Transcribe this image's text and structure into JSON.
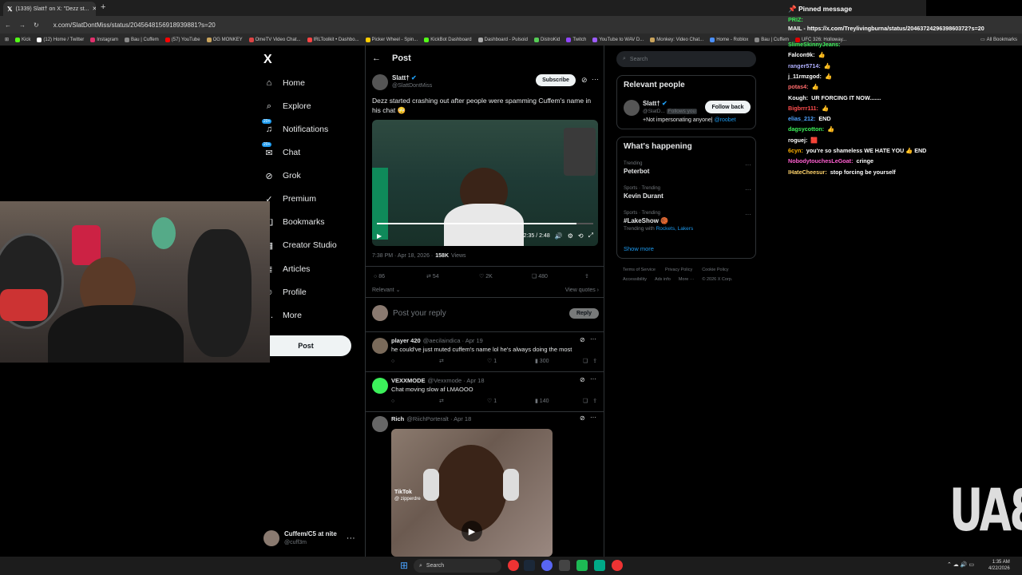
{
  "browser": {
    "tab_title": "(1339) Slatt† on X: \"Dezz st...",
    "url": "x.com/SlatDontMiss/status/2045648156918939881?s=20",
    "new_tab": "+",
    "bookmarks": [
      "Kick",
      "(12) Home / Twitter",
      "Instagram",
      "Bau | Cuffem",
      "(57) YouTube",
      "OG MONKEY",
      "OmeTV Video Chat...",
      "IRLToolkit • Dashbo...",
      "Picker Wheel - Spin...",
      "KickBot Dashboard",
      "Dashboard - Pulsoid",
      "DistroKid",
      "Twitch",
      "YouTube to WAV D...",
      "Monkey: Video Chat...",
      "Home - Roblox",
      "Bau | Cuffem",
      "UFC 326: Holloway..."
    ],
    "all_bookmarks": "All Bookmarks"
  },
  "nav": {
    "logo": "X",
    "items": [
      {
        "label": "Home",
        "icon": "home-icon",
        "glyph": "⌂"
      },
      {
        "label": "Explore",
        "icon": "search-icon",
        "glyph": "⌕"
      },
      {
        "label": "Notifications",
        "icon": "bell-icon",
        "glyph": "♫",
        "badge": "20+"
      },
      {
        "label": "Chat",
        "icon": "chat-icon",
        "glyph": "✉",
        "badge": "20+"
      },
      {
        "label": "Grok",
        "icon": "grok-icon",
        "glyph": "⊘"
      },
      {
        "label": "Premium",
        "icon": "premium-icon",
        "glyph": "✓"
      },
      {
        "label": "Bookmarks",
        "icon": "bookmark-icon",
        "glyph": "❏"
      },
      {
        "label": "Creator Studio",
        "icon": "studio-icon",
        "glyph": "▦"
      },
      {
        "label": "Articles",
        "icon": "articles-icon",
        "glyph": "≣"
      },
      {
        "label": "Profile",
        "icon": "profile-icon",
        "glyph": "☺"
      },
      {
        "label": "More",
        "icon": "more-icon",
        "glyph": "…"
      }
    ],
    "post_button": "Post",
    "account_name": "Cuffem/C5 at nite",
    "account_handle": "@cuff3m"
  },
  "post": {
    "header": "Post",
    "author_name": "Slatt†",
    "author_handle": "@SlattDontMiss",
    "subscribe": "Subscribe",
    "text": "Dezz started crashing out after people were spamming Cuffem's name in his chat 😳",
    "video_time": "2:35 / 2:48",
    "timestamp": "7:38 PM · Apr 18, 2026 ·",
    "views_count": "158K",
    "views_label": "Views",
    "replies": "86",
    "reposts": "54",
    "likes": "2K",
    "bookmarks": "480",
    "relevant": "Relevant",
    "view_quotes": "View quotes",
    "reply_placeholder": "Post your reply",
    "reply_button": "Reply"
  },
  "replies": [
    {
      "name": "player 420",
      "handle": "@aecilaindica · Apr 19",
      "text": "he could've just muted cuffem's name lol he's always doing the most",
      "replies": "",
      "reposts": "",
      "likes": "1",
      "views": "300"
    },
    {
      "name": "VEXXMODE",
      "handle": "@Vexxmode · Apr 18",
      "text": "Chat moving slow af LMAOOO",
      "replies": "",
      "reposts": "",
      "likes": "1",
      "views": "140"
    },
    {
      "name": "Rich",
      "handle": "@RiichPorteralt · Apr 18",
      "text": "",
      "tiktok_label": "TikTok",
      "tiktok_handle": "@ zipperdre"
    }
  ],
  "right": {
    "search_placeholder": "Search",
    "relevant_title": "Relevant people",
    "person_name": "Slatt†",
    "person_handle": "@SlatD...",
    "follows_you": "Follows you",
    "follow_back": "Follow back",
    "bio": "+Not impersonating anyone|",
    "bio_link": "@roobet",
    "happening_title": "What's happening",
    "trends": [
      {
        "meta": "Trending",
        "name": "Peterbot",
        "extra": ""
      },
      {
        "meta": "Sports · Trending",
        "name": "Kevin Durant",
        "extra": ""
      },
      {
        "meta": "Sports · Trending",
        "name": "#LakeShow 🏀",
        "extra": "Trending with",
        "links": "Rockets, Lakers"
      }
    ],
    "show_more": "Show more",
    "footer1": [
      "Terms of Service",
      "Privacy Policy",
      "Cookie Policy"
    ],
    "footer2": [
      "Accessibility",
      "Ads info",
      "More ···",
      "© 2026 X Corp."
    ]
  },
  "chat": {
    "pinned": "Pinned message",
    "prize_label": "PRIZ:",
    "prize_text": "MAIL - https://x.com/Treylivingburna/status/2046372429639860372?s=20",
    "lines": [
      {
        "user": "SlimeSkinnyJeans:",
        "msg": "",
        "color": "#3cf05a"
      },
      {
        "user": "Falcon9k:",
        "msg": "👍",
        "color": "#ffffff"
      },
      {
        "user": "ranger5714:",
        "msg": "👍",
        "color": "#b0b0ff"
      },
      {
        "user": "j_11rmzgod:",
        "msg": "👍",
        "color": "#ffffff"
      },
      {
        "user": "potas4:",
        "msg": "👍",
        "color": "#ff6b6b"
      },
      {
        "user": "Kough:",
        "msg": "UR FORCING IT NOW.......",
        "color": "#ffffff"
      },
      {
        "user": "Bigbrrr111:",
        "msg": "👍",
        "color": "#ff4d4d"
      },
      {
        "user": "elias_212:",
        "msg": "END",
        "color": "#4fa3ff"
      },
      {
        "user": "dagsycotton:",
        "msg": "👍",
        "color": "#3cf05a"
      },
      {
        "user": "roguej:",
        "msg": "🟥",
        "color": "#ffffff"
      },
      {
        "user": "6cyn:",
        "msg": "you're so shameless WE HATE YOU 👍 END",
        "color": "#ffb000"
      },
      {
        "user": "NobodytouchesLeGoat:",
        "msg": "cringe",
        "color": "#ff5fd0"
      },
      {
        "user": "IHateCheesur:",
        "msg": "stop forcing be yourself",
        "color": "#ffd36b"
      }
    ]
  },
  "taskbar": {
    "search": "Search",
    "time": "1:35 AM",
    "date": "4/22/2026"
  },
  "watermark": "BAU"
}
